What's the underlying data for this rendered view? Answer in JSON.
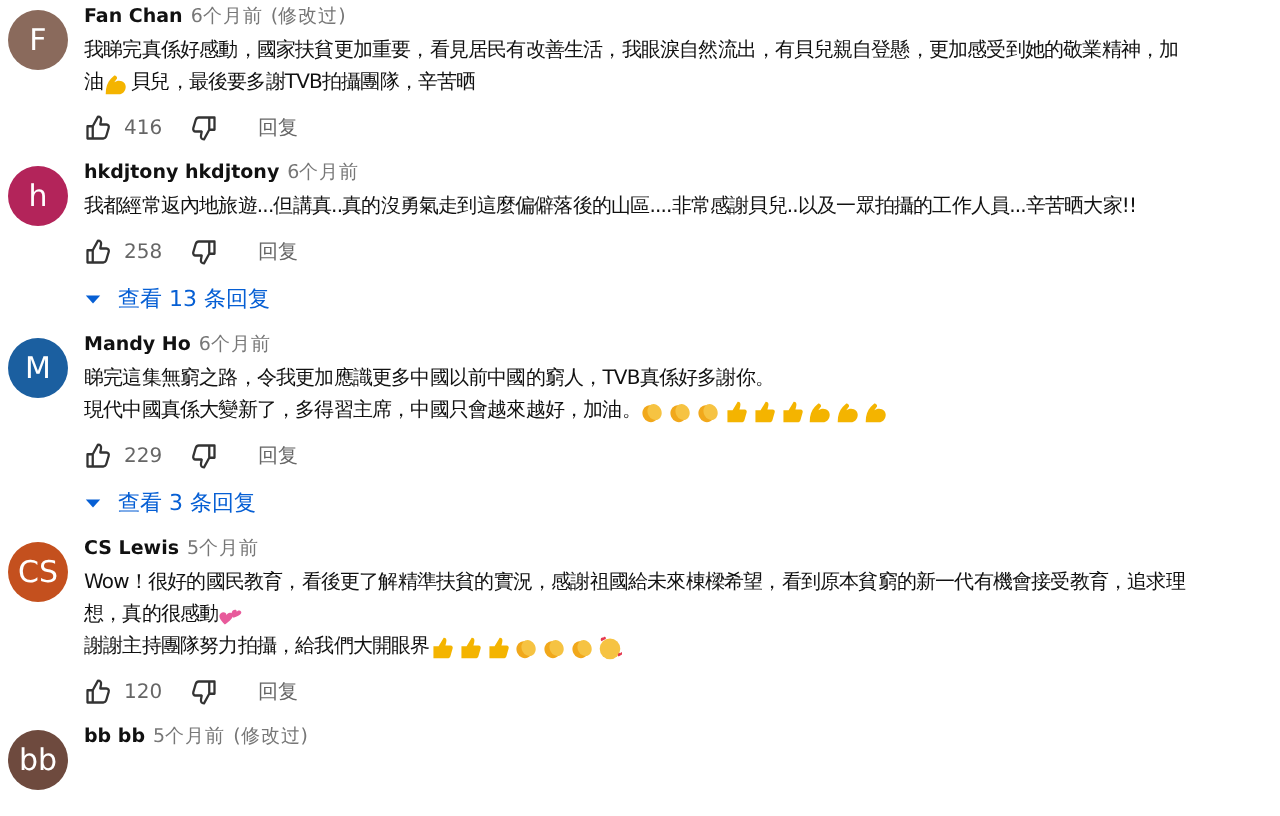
{
  "comments": [
    {
      "avatar": "F",
      "color": "#8a6a5c",
      "author": "Fan Chan",
      "time": "6个月前",
      "edited": "(修改过)",
      "lines": [
        [
          {
            "kind": "text",
            "text": "我睇完真係好感動，國家扶貧更加重要，看見居民有改善生活，我眼淚自然流出，有貝兒親自登懸，更加感受到她的敬業精神，加"
          }
        ],
        [
          {
            "kind": "text",
            "text": "油"
          },
          {
            "kind": "muscle"
          },
          {
            "kind": "text",
            "text": "貝兒，最後要多謝TVB拍攝團隊，辛苦晒"
          }
        ]
      ],
      "likes": "416",
      "reply": "回复"
    },
    {
      "avatar": "h",
      "color": "#b3245a",
      "author": "hkdjtony hkdjtony",
      "time": "6个月前",
      "lines": [
        [
          {
            "kind": "text",
            "text": "我都經常返內地旅遊...但講真..真的沒勇氣走到這麼偏僻落後的山區....非常感謝貝兒..以及一眾拍攝的工作人員...辛苦晒大家!!"
          }
        ]
      ],
      "likes": "258",
      "reply": "回复",
      "replies": "查看 13 条回复"
    },
    {
      "avatar": "M",
      "color": "#1b5fa0",
      "author": "Mandy Ho",
      "time": "6个月前",
      "lines": [
        [
          {
            "kind": "text",
            "text": "睇完這集無窮之路，令我更加應識更多中國以前中國的窮人，TVB真係好多謝你。"
          }
        ],
        [
          {
            "kind": "text",
            "text": "現代中國真係大變新了，多得習主席，中國只會越來越好，加油。"
          },
          {
            "kind": "clap"
          },
          {
            "kind": "clap"
          },
          {
            "kind": "clap"
          },
          {
            "kind": "thumb"
          },
          {
            "kind": "thumb"
          },
          {
            "kind": "thumb"
          },
          {
            "kind": "muscle"
          },
          {
            "kind": "muscle"
          },
          {
            "kind": "muscle"
          }
        ]
      ],
      "likes": "229",
      "reply": "回复",
      "replies": "查看 3 条回复"
    },
    {
      "avatar": "CS",
      "color": "#c4501e",
      "author": "CS Lewis",
      "time": "5个月前",
      "lines": [
        [
          {
            "kind": "text",
            "text": "Wow！很好的國民教育，看後更了解精準扶貧的實況，感謝祖國給未來棟樑希望，看到原本貧窮的新一代有機會接受教育，追求理"
          }
        ],
        [
          {
            "kind": "text",
            "text": "想，真的很感動"
          },
          {
            "kind": "hearts"
          }
        ],
        [
          {
            "kind": "text",
            "text": "謝謝主持團隊努力拍攝，給我們大開眼界"
          },
          {
            "kind": "thumb"
          },
          {
            "kind": "thumb"
          },
          {
            "kind": "thumb"
          },
          {
            "kind": "clap"
          },
          {
            "kind": "clap"
          },
          {
            "kind": "clap"
          },
          {
            "kind": "heartface"
          }
        ]
      ],
      "likes": "120",
      "reply": "回复"
    },
    {
      "avatar": "bb",
      "color": "#6e4a3e",
      "author": "bb bb",
      "time": "5个月前",
      "edited": "(修改过)"
    }
  ]
}
